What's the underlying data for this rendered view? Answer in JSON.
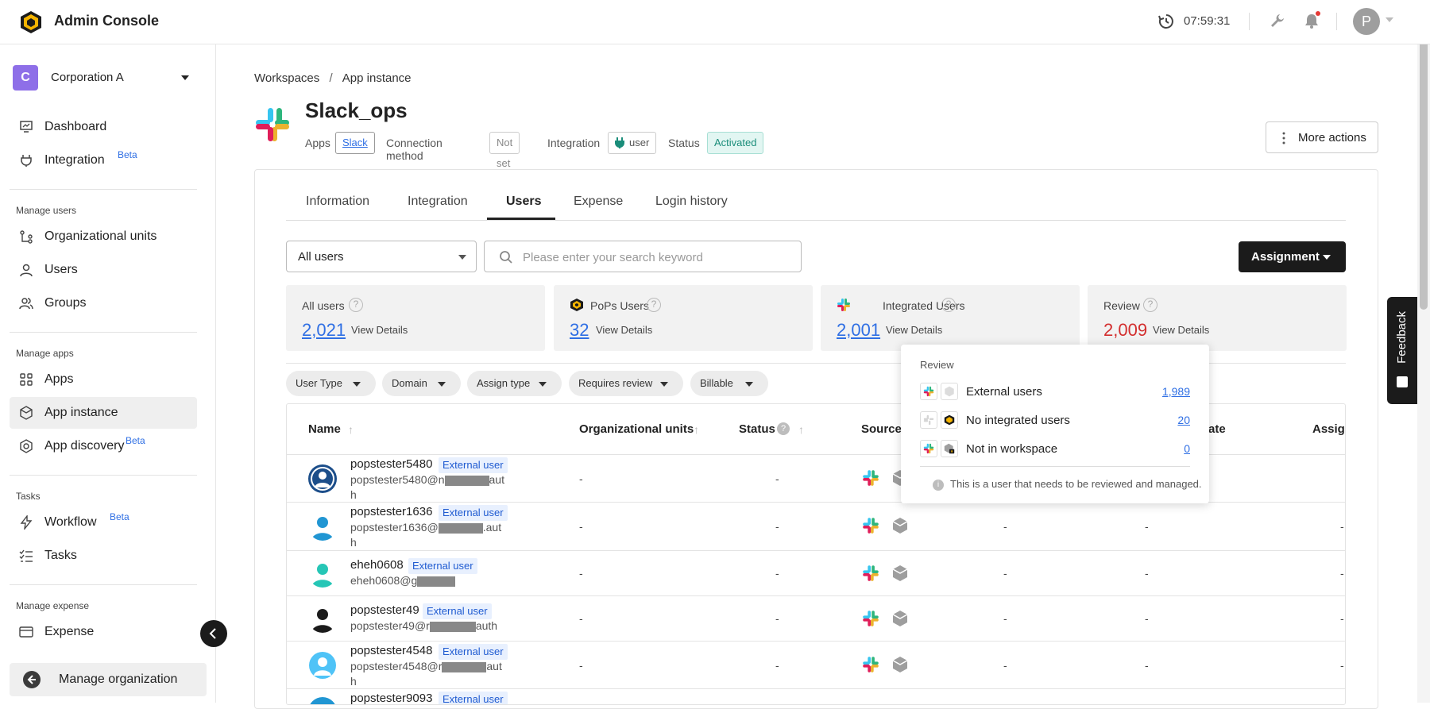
{
  "header": {
    "app_title": "Admin Console",
    "clock": "07:59:31",
    "avatar_initial": "P"
  },
  "sidebar": {
    "org_badge": "C",
    "org_name": "Corporation A",
    "items": [
      {
        "label": "Dashboard"
      },
      {
        "label": "Integration",
        "beta": "Beta"
      },
      {
        "label": "Organizational units"
      },
      {
        "label": "Users"
      },
      {
        "label": "Groups"
      },
      {
        "label": "Apps"
      },
      {
        "label": "App instance"
      },
      {
        "label": "App discovery",
        "beta": "Beta"
      },
      {
        "label": "Workflow",
        "beta": "Beta"
      },
      {
        "label": "Tasks"
      },
      {
        "label": "Expense"
      }
    ],
    "sections": {
      "manage_users": "Manage users",
      "manage_apps": "Manage apps",
      "tasks": "Tasks",
      "manage_expense": "Manage expense"
    },
    "manage_org": "Manage organization"
  },
  "breadcrumb": {
    "root": "Workspaces",
    "sep": "/",
    "current": "App instance"
  },
  "page": {
    "title": "Slack_ops",
    "apps_label": "Apps",
    "apps_value": "Slack",
    "conn_label": "Connection method",
    "conn_value": "Not set",
    "integration_label": "Integration",
    "integration_value": "user",
    "status_label": "Status",
    "status_value": "Activated",
    "more_actions": "More actions"
  },
  "tabs": [
    "Information",
    "Integration",
    "Users",
    "Expense",
    "Login history"
  ],
  "filters": {
    "user_filter": "All users",
    "search_placeholder": "Please enter your search keyword",
    "assignment": "Assignment"
  },
  "stats": [
    {
      "title": "All users",
      "value": "2,021",
      "link": "View Details"
    },
    {
      "title": "PoPs Users",
      "value": "32",
      "link": "View Details"
    },
    {
      "title": "Integrated Users",
      "value": "2,001",
      "link": "View Details"
    },
    {
      "title": "Review",
      "value": "2,009",
      "link": "View Details"
    }
  ],
  "chips": [
    "User Type",
    "Domain",
    "Assign type",
    "Requires review",
    "Billable"
  ],
  "table": {
    "headers": {
      "name": "Name",
      "org_units": "Organizational units",
      "status": "Status",
      "source": "Source",
      "date": "ate",
      "assign": "Assign"
    },
    "badge": "External user",
    "rows": [
      {
        "name": "popstester5480",
        "email_a": "popstester5480@n",
        "email_b": "aut",
        "email_c": "h",
        "org": "-",
        "status": "-",
        "c1": "-",
        "c2": "-",
        "c3": "-"
      },
      {
        "name": "popstester1636",
        "email_a": "popstester1636@",
        "email_b": ".aut",
        "email_c": "h",
        "org": "-",
        "status": "-",
        "c1": "-",
        "c2": "-",
        "c3": "-"
      },
      {
        "name": "eheh0608",
        "email_a": "eheh0608@g",
        "email_b": "",
        "email_c": "",
        "org": "-",
        "status": "-",
        "c1": "-",
        "c2": "-",
        "c3": "-"
      },
      {
        "name": "popstester49",
        "email_a": "popstester49@r",
        "email_b": "auth",
        "email_c": "",
        "org": "-",
        "status": "-",
        "c1": "-",
        "c2": "-",
        "c3": "-"
      },
      {
        "name": "popstester4548",
        "email_a": "popstester4548@r",
        "email_b": "aut",
        "email_c": "h",
        "org": "-",
        "status": "-",
        "c1": "-",
        "c2": "-",
        "c3": "-"
      },
      {
        "name": "popstester9093",
        "email_a": "",
        "email_b": "",
        "email_c": "",
        "org": "",
        "status": "",
        "c1": "",
        "c2": "",
        "c3": ""
      }
    ]
  },
  "popover": {
    "title": "Review",
    "rows": [
      {
        "label": "External users",
        "value": "1,989"
      },
      {
        "label": "No integrated users",
        "value": "20"
      },
      {
        "label": "Not in workspace",
        "value": "0"
      }
    ],
    "info": "This is a user that needs to be reviewed and managed."
  },
  "feedback": "Feedback",
  "colors": {
    "accent_link": "#2f6fe4",
    "review_red": "#d32f2f",
    "status_green": "#1a8d7a",
    "dark_button": "#1b1b1b"
  }
}
